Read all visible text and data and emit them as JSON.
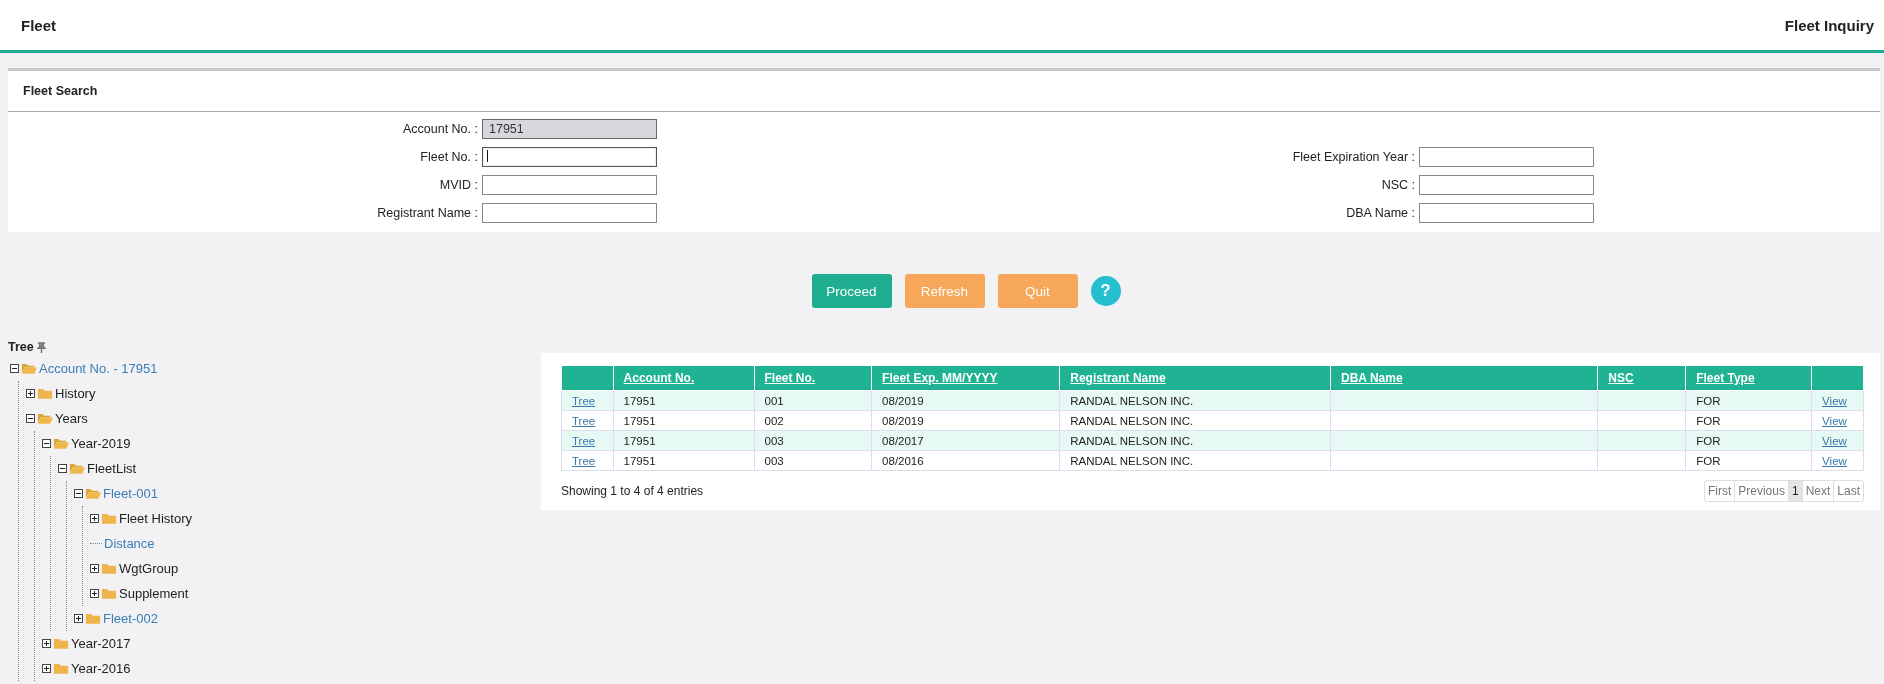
{
  "header": {
    "title": "Fleet",
    "page_title": "Fleet Inquiry"
  },
  "search_panel": {
    "title": "Fleet Search",
    "rows": [
      {
        "left": {
          "label": "Account No. :",
          "value": "17951",
          "disabled": true,
          "focused": false
        }
      },
      {
        "left": {
          "label": "Fleet No. :",
          "disabled": false,
          "focused": true
        },
        "right": {
          "label": "Fleet Expiration Year :",
          "disabled": false,
          "focused": false
        }
      },
      {
        "left": {
          "label": "MVID :",
          "disabled": false,
          "focused": false
        },
        "right": {
          "label": "NSC :",
          "disabled": false,
          "focused": false
        }
      },
      {
        "left": {
          "label": "Registrant Name :",
          "disabled": false,
          "focused": false
        },
        "right": {
          "label": "DBA Name :",
          "disabled": false,
          "focused": false
        }
      }
    ]
  },
  "buttons": [
    {
      "label": "Proceed",
      "kind": "primary"
    },
    {
      "label": "Refresh",
      "kind": "warning"
    },
    {
      "label": "Quit",
      "kind": "warning"
    }
  ],
  "help_button": {
    "label": "?"
  },
  "tree_panel": {
    "title": "Tree",
    "tree": [
      {
        "label": "Account No. - 17951",
        "kind": "folder",
        "expanded": true,
        "linked": true,
        "children": [
          {
            "label": "History",
            "kind": "folder",
            "expanded": false,
            "linked": false
          },
          {
            "label": "Years",
            "kind": "folder",
            "expanded": true,
            "linked": false,
            "children": [
              {
                "label": "Year-2019",
                "kind": "folder",
                "expanded": true,
                "linked": false,
                "children": [
                  {
                    "label": "FleetList",
                    "kind": "folder",
                    "expanded": true,
                    "linked": false,
                    "children": [
                      {
                        "label": "Fleet-001",
                        "kind": "folder",
                        "expanded": true,
                        "linked": true,
                        "children": [
                          {
                            "label": "Fleet History",
                            "kind": "folder",
                            "expanded": false,
                            "linked": false
                          },
                          {
                            "label": "Distance",
                            "kind": "leaf",
                            "linked": true
                          },
                          {
                            "label": "WgtGroup",
                            "kind": "folder",
                            "expanded": false,
                            "linked": false
                          },
                          {
                            "label": "Supplement",
                            "kind": "folder",
                            "expanded": false,
                            "linked": false
                          }
                        ]
                      },
                      {
                        "label": "Fleet-002",
                        "kind": "folder",
                        "expanded": false,
                        "linked": true
                      }
                    ]
                  }
                ]
              },
              {
                "label": "Year-2017",
                "kind": "folder",
                "expanded": false,
                "linked": false
              },
              {
                "label": "Year-2016",
                "kind": "folder",
                "expanded": false,
                "linked": false
              }
            ]
          }
        ]
      }
    ]
  },
  "results": {
    "columns": [
      "Account No.",
      "Fleet No.",
      "Fleet Exp. MM/YYYY",
      "Registrant Name",
      "DBA Name",
      "NSC",
      "Fleet Type"
    ],
    "rows": [
      {
        "tree_link": "Tree",
        "cells": [
          "17951",
          "001",
          "08/2019",
          "RANDAL NELSON INC.",
          null,
          null,
          "FOR"
        ],
        "view_link": "View"
      },
      {
        "tree_link": "Tree",
        "cells": [
          "17951",
          "002",
          "08/2019",
          "RANDAL NELSON INC.",
          null,
          null,
          "FOR"
        ],
        "view_link": "View"
      },
      {
        "tree_link": "Tree",
        "cells": [
          "17951",
          "003",
          "08/2017",
          "RANDAL NELSON INC.",
          null,
          null,
          "FOR"
        ],
        "view_link": "View"
      },
      {
        "tree_link": "Tree",
        "cells": [
          "17951",
          "003",
          "08/2016",
          "RANDAL NELSON INC.",
          null,
          null,
          "FOR"
        ],
        "view_link": "View"
      }
    ],
    "summary": "Showing 1 to 4 of 4 entries",
    "pages": [
      {
        "label": "First",
        "selected": false,
        "disabled": true
      },
      {
        "label": "Previous",
        "selected": false,
        "disabled": true
      },
      {
        "label": "1",
        "selected": true,
        "disabled": false
      },
      {
        "label": "Next",
        "selected": false,
        "disabled": true
      },
      {
        "label": "Last",
        "selected": false,
        "disabled": true
      }
    ]
  }
}
